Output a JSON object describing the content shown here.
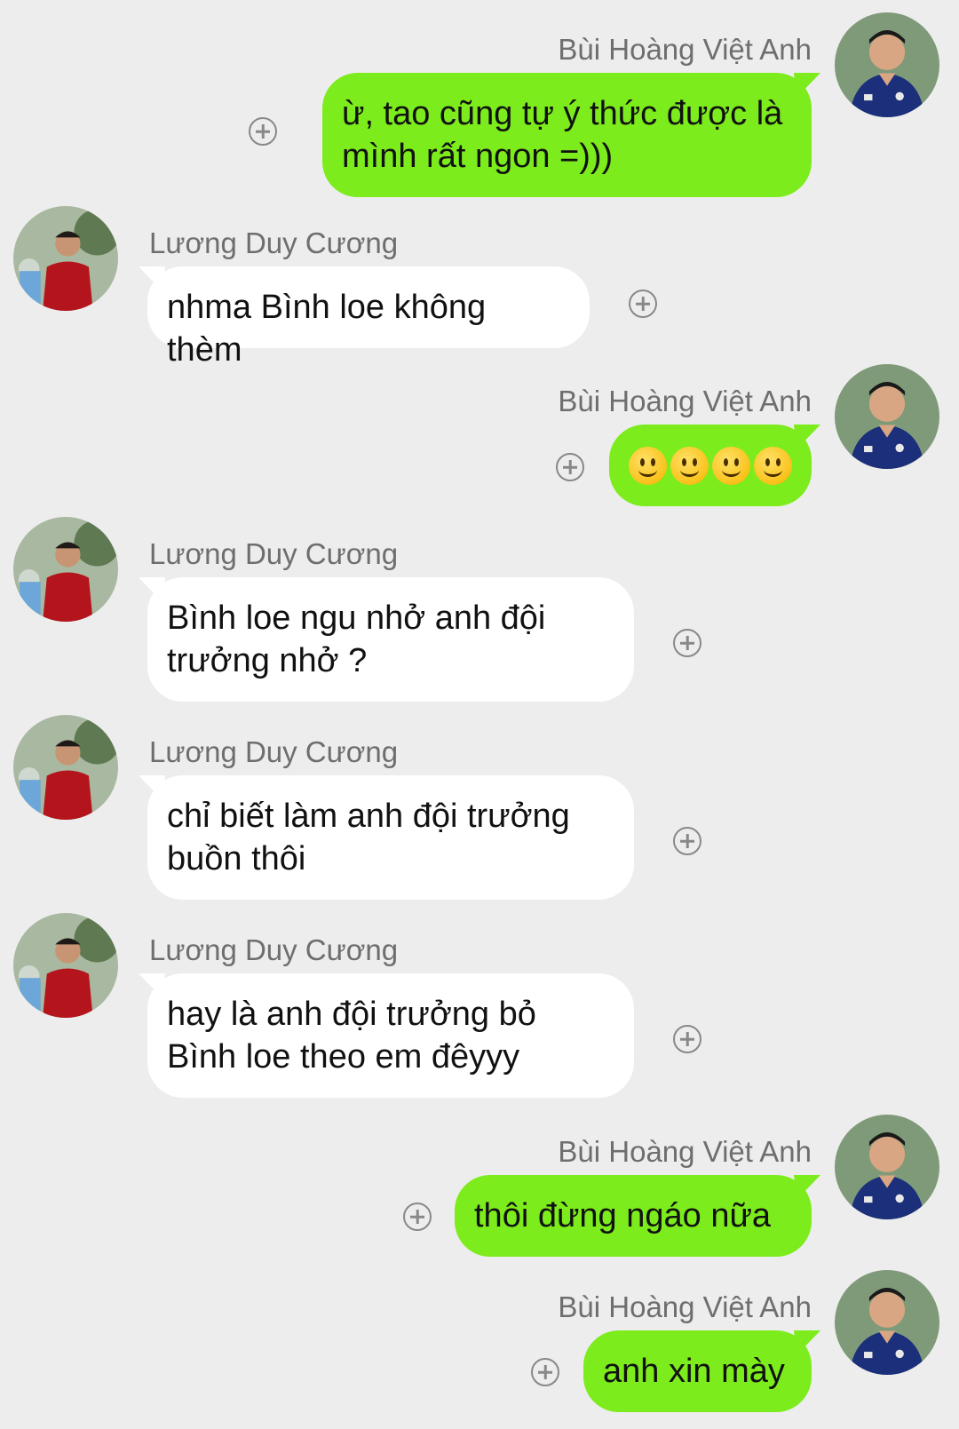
{
  "colors": {
    "background": "#ededed",
    "sent_bubble": "#7cec1c",
    "received_bubble": "#ffffff",
    "name_text": "#6e6e6e",
    "message_text": "#111111"
  },
  "participants": {
    "sender": "Bùi Hoàng Việt Anh",
    "receiver": "Lương Duy Cương"
  },
  "messages": [
    {
      "from": "Bùi Hoàng Việt Anh",
      "side": "sent",
      "text": "ừ, tao cũng tự ý thức được là mình rất ngon =)))"
    },
    {
      "from": "Lương Duy Cương",
      "side": "received",
      "text": "nhma Bình loe không thèm"
    },
    {
      "from": "Bùi Hoàng Việt Anh",
      "side": "sent",
      "emoji": "slightly-smiling-face",
      "emoji_count": 4
    },
    {
      "from": "Lương Duy Cương",
      "side": "received",
      "text": "Bình loe ngu nhở anh đội trưởng nhở ?"
    },
    {
      "from": "Lương Duy Cương",
      "side": "received",
      "text": "chỉ biết làm anh đội trưởng buồn thôi"
    },
    {
      "from": "Lương Duy Cương",
      "side": "received",
      "text": "hay là anh đội trưởng bỏ Bình loe theo em đêyyy"
    },
    {
      "from": "Bùi Hoàng Việt Anh",
      "side": "sent",
      "text": "thôi đừng ngáo nữa"
    },
    {
      "from": "Bùi Hoàng Việt Anh",
      "side": "sent",
      "text": "anh xin mày"
    }
  ],
  "icons": {
    "reaction": "add-reaction-icon",
    "avatar_sender": "avatar-sender",
    "avatar_receiver": "avatar-receiver"
  }
}
